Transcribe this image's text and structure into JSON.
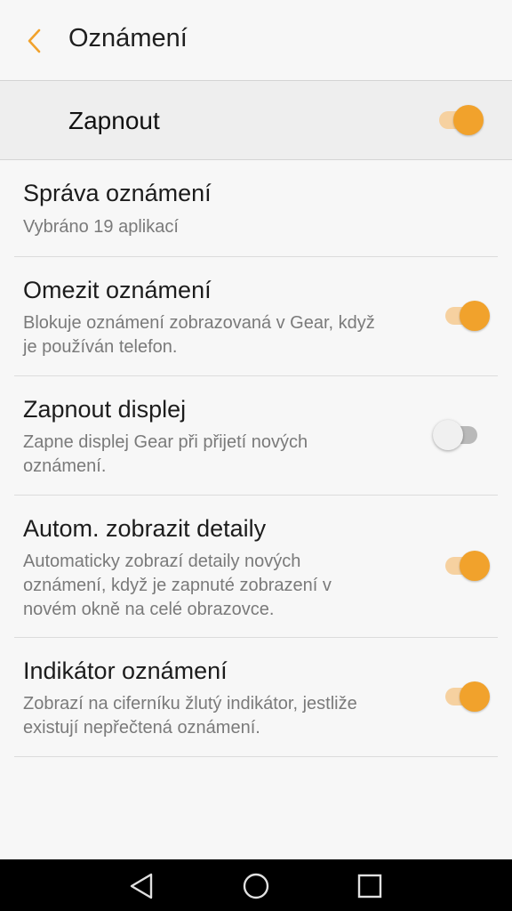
{
  "header": {
    "title": "Oznámení"
  },
  "master": {
    "label": "Zapnout",
    "on": true
  },
  "settings": [
    {
      "title": "Správa oznámení",
      "subtitle": "Vybráno 19 aplikací"
    },
    {
      "title": "Omezit oznámení",
      "subtitle": "Blokuje oznámení zobrazovaná v Gear, když je používán telefon.",
      "on": true
    },
    {
      "title": "Zapnout displej",
      "subtitle": "Zapne displej Gear při přijetí nových oznámení.",
      "on": false
    },
    {
      "title": "Autom. zobrazit detaily",
      "subtitle": "Automaticky zobrazí detaily nových oznámení, když je zapnuté zobrazení v novém okně na celé obrazovce.",
      "on": true
    },
    {
      "title": "Indikátor oznámení",
      "subtitle": "Zobrazí na ciferníku žlutý indikátor, jestliže existují nepřečtená oznámení.",
      "on": true
    }
  ],
  "colors": {
    "accent": "#f1a22c",
    "accent_track": "#f6d1a0",
    "background": "#f7f7f7"
  },
  "icons": {
    "back": "chevron-left-icon",
    "nav_back": "triangle-back-icon",
    "nav_home": "circle-home-icon",
    "nav_recent": "square-recent-icon"
  }
}
